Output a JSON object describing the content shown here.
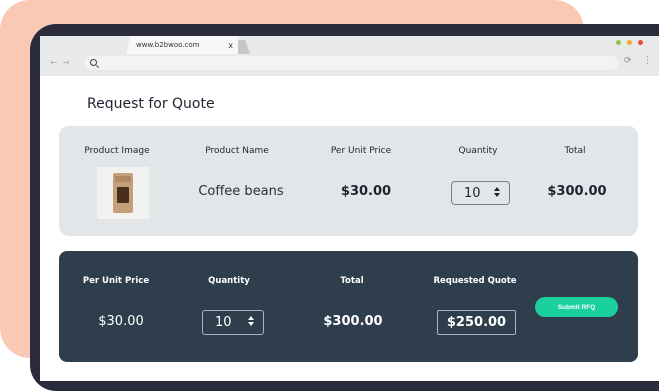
{
  "browser": {
    "tab_url": "www.b2bwoo.com",
    "tab_close": "x",
    "nav_back": "←",
    "nav_forward": "→",
    "reload_glyph": "⟳",
    "menu_glyph": "⋮",
    "dot_colors": [
      "#8fc44f",
      "#f0a830",
      "#e84b3c"
    ]
  },
  "page": {
    "title": "Request for Quote"
  },
  "product_table": {
    "headers": {
      "image": "Product Image",
      "name": "Product Name",
      "unit_price": "Per Unit Price",
      "quantity": "Quantity",
      "total": "Total"
    },
    "row": {
      "name": "Coffee beans",
      "unit_price": "$30.00",
      "quantity": "10",
      "total": "$300.00"
    }
  },
  "quote_summary": {
    "headers": {
      "unit_price": "Per Unit Price",
      "quantity": "Quantity",
      "total": "Total",
      "requested_quote": "Requested Quote"
    },
    "values": {
      "unit_price": "$30.00",
      "quantity": "10",
      "total": "$300.00",
      "requested_quote": "$250.00"
    },
    "submit_label": "Submit RFQ"
  },
  "colors": {
    "accent": "#1ccf9e",
    "summary_bg": "#2f3e4c",
    "table_bg": "#e3e6e9"
  }
}
